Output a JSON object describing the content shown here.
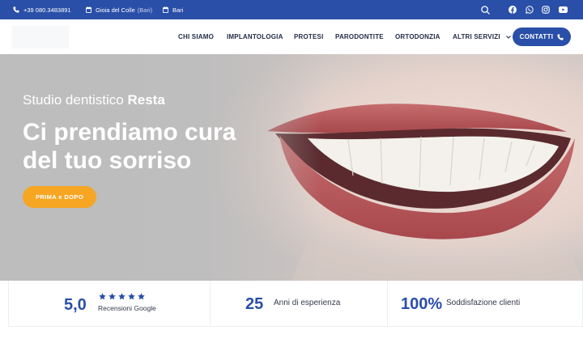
{
  "topbar": {
    "phone": "+39 080.3483891",
    "location1_city": "Gioia del Colle",
    "location1_region": "(Bari)",
    "location2": "Bari",
    "icons": [
      "phone-icon",
      "calendar-icon",
      "calendar-icon",
      "search-icon",
      "facebook-icon",
      "whatsapp-icon",
      "instagram-icon",
      "youtube-icon"
    ]
  },
  "nav": {
    "items": [
      "CHI SIAMO",
      "IMPLANTOLOGIA",
      "PROTESI",
      "PARODONTITE",
      "ORTODONZIA",
      "ALTRI SERVIZI"
    ],
    "cta": "CONTATTI"
  },
  "hero": {
    "subtitle_light": "Studio dentistico",
    "subtitle_bold": "Resta",
    "title_line1": "Ci prendiamo cura",
    "title_line2": "del tuo sorriso",
    "button": "PRIMA e DOPO"
  },
  "stats": {
    "rating": "5,0",
    "rating_label": "Recensioni Google",
    "stars": 5,
    "years": "25",
    "years_label": "Anni di esperienza",
    "satisfaction": "100%",
    "satisfaction_label": "Soddisfazione clienti"
  },
  "colors": {
    "brand_blue": "#2a4fa8",
    "accent_orange": "#f6a623"
  }
}
